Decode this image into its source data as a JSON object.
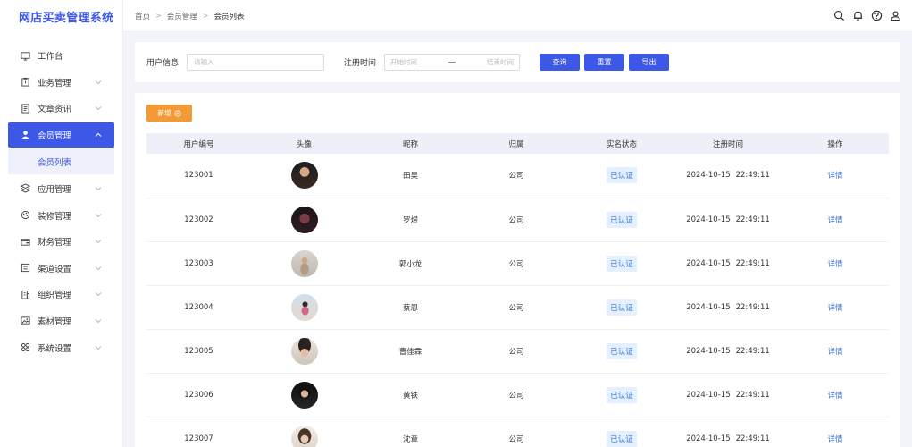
{
  "app": {
    "title": "网店买卖管理系统"
  },
  "sidebar": {
    "items": [
      {
        "label": "工作台",
        "icon": "monitor-icon",
        "expandable": false
      },
      {
        "label": "业务管理",
        "icon": "clipboard-icon",
        "expandable": true
      },
      {
        "label": "文章资讯",
        "icon": "document-icon",
        "expandable": true
      },
      {
        "label": "会员管理",
        "icon": "user-icon",
        "expandable": true,
        "active": true,
        "children": [
          {
            "label": "会员列表"
          }
        ]
      },
      {
        "label": "应用管理",
        "icon": "layers-icon",
        "expandable": true
      },
      {
        "label": "装修管理",
        "icon": "palette-icon",
        "expandable": true
      },
      {
        "label": "财务管理",
        "icon": "wallet-icon",
        "expandable": true
      },
      {
        "label": "渠道设置",
        "icon": "list-icon",
        "expandable": true
      },
      {
        "label": "组织管理",
        "icon": "building-icon",
        "expandable": true
      },
      {
        "label": "素材管理",
        "icon": "image-icon",
        "expandable": true
      },
      {
        "label": "系统设置",
        "icon": "grid-icon",
        "expandable": true
      }
    ]
  },
  "breadcrumb": [
    "首页",
    "会员管理",
    "会员列表"
  ],
  "header_icons": [
    "search-icon",
    "bell-icon",
    "help-icon",
    "account-icon"
  ],
  "filters": {
    "user_label": "用户信息",
    "user_placeholder": "请输入",
    "time_label": "注册时间",
    "start_placeholder": "开始时间",
    "range_sep": "一",
    "end_placeholder": "结束时间",
    "query_btn": "查询",
    "reset_btn": "重置",
    "export_btn": "导出"
  },
  "table": {
    "add_btn": "新增",
    "columns": [
      "用户编号",
      "头像",
      "昵称",
      "归属",
      "实名状态",
      "注册时间",
      "操作"
    ],
    "rows": [
      {
        "id": "123001",
        "name": "田昊",
        "org": "公司",
        "status": "已认证",
        "date": "2024-10-15",
        "time": "22:49:11",
        "action": "详情"
      },
      {
        "id": "123002",
        "name": "罗煜",
        "org": "公司",
        "status": "已认证",
        "date": "2024-10-15",
        "time": "22:49:11",
        "action": "详情"
      },
      {
        "id": "123003",
        "name": "郭小龙",
        "org": "公司",
        "status": "已认证",
        "date": "2024-10-15",
        "time": "22:49:11",
        "action": "详情"
      },
      {
        "id": "123004",
        "name": "蔡恩",
        "org": "公司",
        "status": "已认证",
        "date": "2024-10-15",
        "time": "22:49:11",
        "action": "详情"
      },
      {
        "id": "123005",
        "name": "曹佳霖",
        "org": "公司",
        "status": "已认证",
        "date": "2024-10-15",
        "time": "22:49:11",
        "action": "详情"
      },
      {
        "id": "123006",
        "name": "黄铁",
        "org": "公司",
        "status": "已认证",
        "date": "2024-10-15",
        "time": "22:49:11",
        "action": "详情"
      },
      {
        "id": "123007",
        "name": "沈章",
        "org": "公司",
        "status": "已认证",
        "date": "2024-10-15",
        "time": "22:49:11",
        "action": "详情"
      }
    ]
  },
  "colors": {
    "primary": "#3d57e6",
    "accent": "#f29b36",
    "badge_bg": "#e4efff",
    "badge_text": "#3a77d8"
  }
}
